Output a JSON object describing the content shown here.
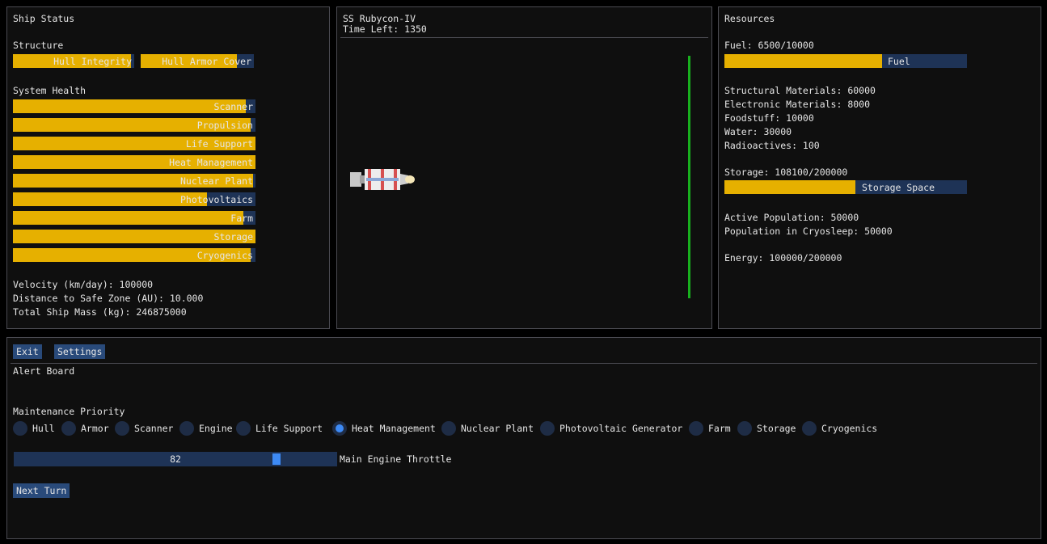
{
  "ship_status": {
    "title": "Ship Status",
    "structure_label": "Structure",
    "structure_bars": [
      {
        "label": "Hull Integrity",
        "level": 0.97
      },
      {
        "label": "Hull Armor Cover",
        "level": 0.85
      }
    ],
    "system_health_label": "System Health",
    "system_bars": [
      {
        "label": "Scanner",
        "level": 0.96
      },
      {
        "label": "Propulsion",
        "level": 0.98
      },
      {
        "label": "Life Support",
        "level": 1.0
      },
      {
        "label": "Heat Management",
        "level": 1.0
      },
      {
        "label": "Nuclear Plant",
        "level": 0.99
      },
      {
        "label": "Photovoltaics",
        "level": 0.8
      },
      {
        "label": "Farm",
        "level": 0.95
      },
      {
        "label": "Storage",
        "level": 1.0
      },
      {
        "label": "Cryogenics",
        "level": 0.98
      }
    ],
    "velocity": "Velocity (km/day): 100000",
    "distance": "Distance to Safe Zone (AU): 10.000",
    "mass": "Total Ship Mass (kg): 246875000"
  },
  "viewport": {
    "ship_name": "SS Rubycon-IV",
    "time_left": "Time Left: 1350",
    "distance_line_color": "#18b01e"
  },
  "resources": {
    "title": "Resources",
    "fuel_text": "Fuel: 6500/10000",
    "fuel_bar": {
      "label": "Fuel",
      "level": 0.65
    },
    "structural": "Structural Materials: 60000",
    "electronic": "Electronic Materials: 8000",
    "foodstuff": "Foodstuff: 10000",
    "water": "Water: 30000",
    "radioactives": "Radioactives: 100",
    "storage_text": "Storage: 108100/200000",
    "storage_bar": {
      "label": "Storage Space",
      "level": 0.54
    },
    "active_population": "Active Population: 50000",
    "cryosleep_population": "Population in Cryosleep: 50000",
    "energy": "Energy: 100000/200000"
  },
  "controls": {
    "exit_label": "Exit",
    "settings_label": "Settings",
    "alert_board_label": "Alert Board",
    "maintenance_label": "Maintenance Priority",
    "priority_options": [
      "Hull",
      "Armor",
      "Scanner",
      "Engine",
      "Life Support",
      "Heat Management",
      "Nuclear Plant",
      "Photovoltaic Generator",
      "Farm",
      "Storage",
      "Cryogenics"
    ],
    "priority_selected": "Heat Management",
    "throttle_value": "82",
    "throttle_level": 0.82,
    "throttle_label": "Main Engine Throttle",
    "next_turn_label": "Next Turn"
  },
  "colors": {
    "bar_fill": "#e6b000",
    "bar_background": "#1e3356",
    "accent": "#3d8af5"
  }
}
